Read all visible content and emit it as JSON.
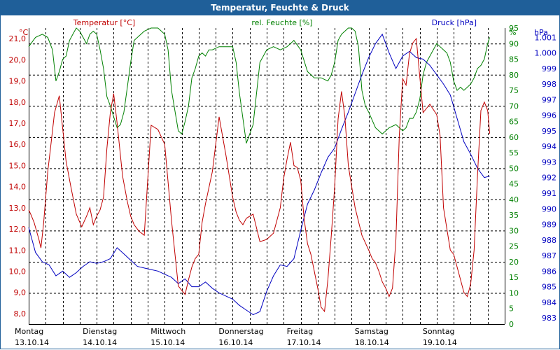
{
  "window": {
    "title": "Temperatur, Feuchte & Druck"
  },
  "colors": {
    "temperature": "#c00000",
    "humidity": "#008000",
    "pressure": "#0000c0",
    "grid": "#000000",
    "title_bar": "#1f5f99"
  },
  "chart_data": {
    "type": "line",
    "title": "Temperatur, Feuchte & Druck",
    "grid": true,
    "x_start": "13.10.14 00:00",
    "x_end": "20.10.14 00:00",
    "x_categories": [
      {
        "day": "Montag",
        "date": "13.10.14"
      },
      {
        "day": "Dienstag",
        "date": "14.10.14"
      },
      {
        "day": "Mittwoch",
        "date": "15.10.14"
      },
      {
        "day": "Donnerstag",
        "date": "16.10.14"
      },
      {
        "day": "Freitag",
        "date": "17.10.14"
      },
      {
        "day": "Samstag",
        "date": "18.10.14"
      },
      {
        "day": "Sonntag",
        "date": "19.10.14"
      }
    ],
    "axes": {
      "temperature": {
        "label": "Temperatur [°C]",
        "unit": "°C",
        "min": 7.5,
        "max": 21.5,
        "ticks": [
          "8,0",
          "9,0",
          "10,0",
          "11,0",
          "12,0",
          "13,0",
          "14,0",
          "15,0",
          "16,0",
          "17,0",
          "18,0",
          "19,0",
          "20,0",
          "21,0"
        ]
      },
      "humidity": {
        "label": "rel. Feuchte [%]",
        "unit": "%",
        "min": 0,
        "max": 95,
        "ticks": [
          "0",
          "5",
          "10",
          "15",
          "20",
          "25",
          "30",
          "35",
          "40",
          "45",
          "50",
          "55",
          "60",
          "65",
          "70",
          "75",
          "80",
          "85",
          "90",
          "95"
        ]
      },
      "pressure": {
        "label": "Druck [hPa]",
        "unit": "hPa",
        "min": 982.6,
        "max": 1001.6,
        "ticks": [
          "983",
          "984",
          "985",
          "986",
          "987",
          "988",
          "989",
          "990",
          "991",
          "992",
          "993",
          "994",
          "995",
          "996",
          "997",
          "998",
          "999",
          "1.000",
          "1.001"
        ]
      }
    },
    "series": [
      {
        "name": "Temperatur [°C]",
        "axis": "temperature",
        "x": [
          0,
          0.03,
          0.08,
          0.15,
          0.18,
          0.22,
          0.28,
          0.32,
          0.38,
          0.45,
          0.55,
          0.62,
          0.7,
          0.78,
          0.85,
          0.9,
          0.95,
          1,
          1.05,
          1.1,
          1.15,
          1.2,
          1.25,
          1.3,
          1.38,
          1.45,
          1.5,
          1.55,
          1.62,
          1.7,
          1.8,
          1.9,
          2,
          2.1,
          2.2,
          2.3,
          2.35,
          2.4,
          2.45,
          2.5,
          2.55,
          2.6,
          2.7,
          2.8,
          2.9,
          3,
          3.05,
          3.1,
          3.15,
          3.2,
          3.3,
          3.4,
          3.5,
          3.6,
          3.7,
          3.75,
          3.8,
          3.85,
          3.9,
          3.95,
          4,
          4.05,
          4.1,
          4.15,
          4.2,
          4.25,
          4.3,
          4.35,
          4.4,
          4.45,
          4.5,
          4.55,
          4.6,
          4.65,
          4.7,
          4.8,
          4.9,
          5,
          5.05,
          5.1,
          5.15,
          5.2,
          5.25,
          5.3,
          5.35,
          5.4,
          5.45,
          5.5,
          5.55,
          5.6,
          5.65,
          5.7,
          5.8,
          5.9,
          6,
          6.05,
          6.1,
          6.15,
          6.2,
          6.25,
          6.3,
          6.35,
          6.4,
          6.45,
          6.5,
          6.55,
          6.6,
          6.65,
          6.7,
          6.75,
          6.78
        ],
        "values": [
          12.9,
          12.7,
          12.3,
          11.5,
          11.1,
          12.3,
          14.7,
          15.8,
          17.5,
          18.3,
          15.2,
          14.0,
          12.7,
          12.1,
          12.6,
          13.0,
          12.2,
          12.6,
          12.9,
          13.5,
          15.8,
          17.5,
          18.4,
          17.0,
          14.5,
          13.3,
          12.6,
          12.2,
          11.9,
          11.7,
          16.9,
          16.7,
          16.0,
          12.4,
          9.3,
          8.9,
          9.6,
          10.2,
          10.6,
          10.8,
          12.3,
          13.2,
          14.7,
          17.3,
          15.5,
          13.5,
          12.8,
          12.4,
          12.2,
          12.5,
          12.7,
          11.4,
          11.5,
          11.8,
          13.0,
          14.4,
          15.3,
          16.1,
          15.0,
          14.9,
          14.3,
          12.5,
          11.3,
          10.8,
          10.0,
          9.2,
          8.3,
          8.1,
          9.6,
          11.7,
          14.0,
          17.2,
          18.5,
          17.3,
          15.0,
          13.0,
          11.7,
          11.0,
          10.6,
          10.4,
          10.0,
          9.5,
          9.2,
          8.8,
          9.2,
          11.5,
          16.4,
          19.1,
          18.8,
          20.3,
          20.8,
          21.0,
          17.5,
          17.9,
          17.4,
          16.4,
          13.0,
          12.0,
          11.0,
          10.8,
          10.2,
          9.6,
          9.0,
          8.8,
          9.4,
          11.0,
          14.5,
          17.6,
          18.0,
          17.6,
          16.5
        ]
      },
      {
        "name": "rel. Feuchte [%]",
        "axis": "humidity",
        "x": [
          0,
          0.1,
          0.2,
          0.28,
          0.35,
          0.4,
          0.45,
          0.5,
          0.55,
          0.6,
          0.65,
          0.7,
          0.75,
          0.8,
          0.85,
          0.9,
          0.95,
          1,
          1.05,
          1.1,
          1.15,
          1.2,
          1.3,
          1.35,
          1.4,
          1.45,
          1.5,
          1.55,
          1.6,
          1.65,
          1.7,
          1.8,
          1.9,
          2,
          2.05,
          2.1,
          2.2,
          2.25,
          2.3,
          2.35,
          2.4,
          2.45,
          2.5,
          2.55,
          2.6,
          2.65,
          2.7,
          2.8,
          2.9,
          3,
          3.05,
          3.1,
          3.2,
          3.3,
          3.4,
          3.5,
          3.6,
          3.7,
          3.8,
          3.9,
          4,
          4.1,
          4.2,
          4.3,
          4.4,
          4.45,
          4.5,
          4.55,
          4.6,
          4.65,
          4.7,
          4.75,
          4.8,
          4.85,
          4.9,
          4.95,
          5,
          5.1,
          5.2,
          5.3,
          5.4,
          5.5,
          5.55,
          5.6,
          5.65,
          5.7,
          5.75,
          5.8,
          5.85,
          5.9,
          6,
          6.1,
          6.15,
          6.2,
          6.25,
          6.3,
          6.35,
          6.4,
          6.45,
          6.5,
          6.55,
          6.6,
          6.65,
          6.7,
          6.75,
          6.78
        ],
        "values": [
          89,
          92,
          93,
          92,
          88,
          78,
          81,
          85,
          86,
          91,
          93,
          95,
          94,
          92,
          90,
          93,
          94,
          93,
          88,
          82,
          73,
          70,
          63,
          64,
          68,
          76,
          84,
          91,
          92,
          93,
          94,
          95,
          95,
          93,
          88,
          75,
          62,
          61,
          65,
          70,
          79,
          82,
          86,
          87,
          86,
          88,
          88,
          89,
          89,
          89,
          84,
          74,
          58,
          64,
          84,
          88,
          89,
          88,
          89,
          91,
          88,
          81,
          79,
          79,
          78,
          80,
          84,
          91,
          93,
          94,
          95,
          95,
          94,
          89,
          75,
          70,
          68,
          63,
          61,
          63,
          64,
          62,
          63,
          66,
          66,
          68,
          72,
          80,
          84,
          86,
          90,
          88,
          87,
          84,
          78,
          75,
          76,
          75,
          76,
          77,
          79,
          82,
          83,
          85,
          90,
          92
        ]
      },
      {
        "name": "Druck [hPa]",
        "axis": "pressure",
        "x": [
          0,
          0.1,
          0.2,
          0.3,
          0.4,
          0.5,
          0.6,
          0.7,
          0.8,
          0.9,
          1,
          1.1,
          1.2,
          1.3,
          1.4,
          1.5,
          1.6,
          1.7,
          1.8,
          1.9,
          2,
          2.1,
          2.2,
          2.3,
          2.4,
          2.5,
          2.6,
          2.7,
          2.8,
          2.9,
          3,
          3.1,
          3.2,
          3.3,
          3.4,
          3.5,
          3.6,
          3.7,
          3.8,
          3.9,
          4,
          4.1,
          4.2,
          4.3,
          4.4,
          4.5,
          4.6,
          4.7,
          4.8,
          4.9,
          5,
          5.1,
          5.2,
          5.3,
          5.4,
          5.5,
          5.6,
          5.7,
          5.8,
          5.9,
          6,
          6.1,
          6.2,
          6.3,
          6.4,
          6.5,
          6.6,
          6.7,
          6.78
        ],
        "values": [
          988.8,
          987.2,
          986.6,
          986.4,
          985.7,
          986.0,
          985.6,
          985.9,
          986.3,
          986.6,
          986.5,
          986.6,
          986.8,
          987.5,
          987.1,
          986.7,
          986.3,
          986.2,
          986.1,
          986.0,
          985.8,
          985.6,
          985.2,
          985.5,
          985.0,
          985.0,
          985.3,
          984.9,
          984.6,
          984.4,
          984.2,
          983.8,
          983.5,
          983.2,
          983.4,
          984.7,
          985.7,
          986.4,
          986.3,
          986.8,
          988.6,
          990.3,
          991.2,
          992.3,
          993.3,
          993.9,
          995.1,
          996.2,
          997.4,
          998.6,
          999.7,
          1000.6,
          1001.2,
          1000.0,
          999.0,
          999.8,
          1000.1,
          999.7,
          999.6,
          999.2,
          998.6,
          998.0,
          997.3,
          995.8,
          994.3,
          993.5,
          992.6,
          992.0,
          992.1
        ]
      }
    ]
  }
}
